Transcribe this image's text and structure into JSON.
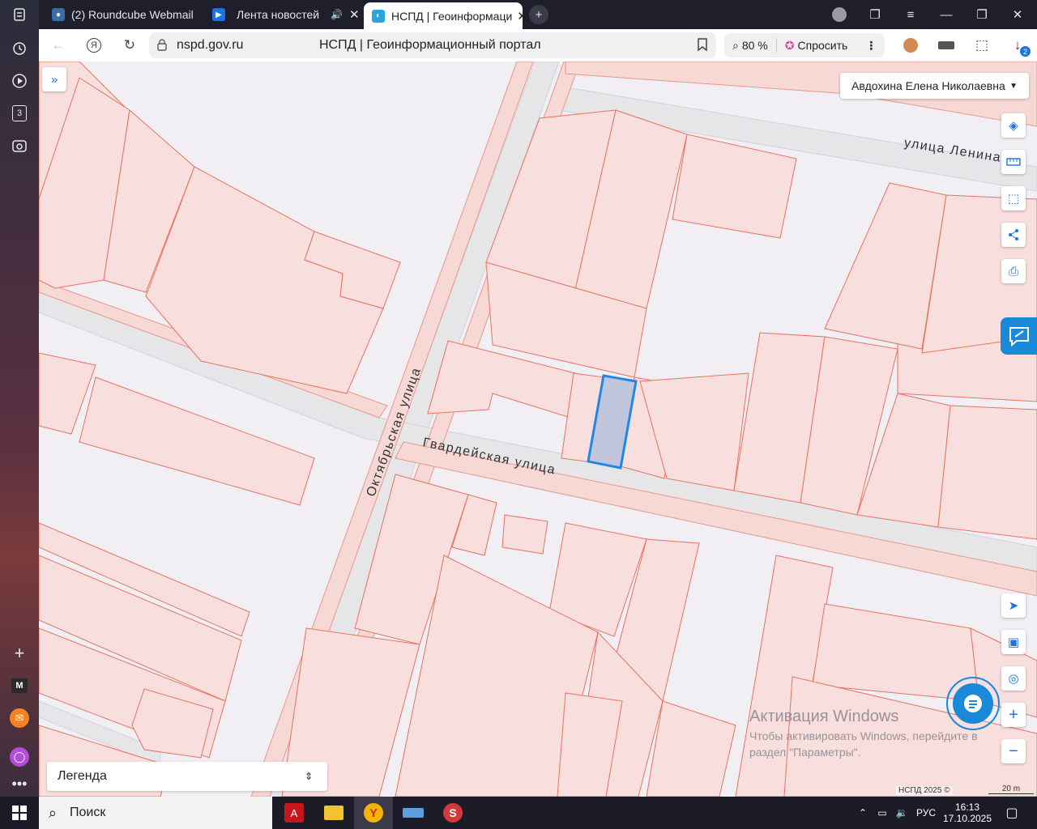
{
  "browser": {
    "tabs": [
      {
        "label": "(2) Roundcube Webmail ::",
        "icon": "roundcube-icon"
      },
      {
        "label": "Лента новостей",
        "icon": "video-play-icon"
      },
      {
        "label": "НСПД | Геоинформаци",
        "icon": "nspd-globe-icon",
        "active": true
      }
    ],
    "address": {
      "host": "nspd.gov.ru",
      "page_title": "НСПД | Геоинформационный портал",
      "zoom": "80 %",
      "ask_label": "Спросить"
    },
    "download_badge": "2",
    "sidebar_badge": "3",
    "sidebar_m": "M"
  },
  "map": {
    "user_name": "Авдохина Елена Николаевна",
    "streets": {
      "lenina": "улица  Ленина",
      "oktyabrskaya": "Октябрьская  улица",
      "gvardeyskaya": "Гвардейская  улица"
    },
    "legend_label": "Легенда",
    "watermark": {
      "title": "Активация Windows",
      "text": "Чтобы активировать Windows, перейдите в раздел \"Параметры\"."
    },
    "attribution": "НСПД 2025 ©",
    "scale_label": "20 m",
    "colors": {
      "parcel_stroke": "#e8735f",
      "parcel_fill": "#f8dedd",
      "selected_stroke": "#1e88e5",
      "selected_fill": "#c2c6dc",
      "road": "#e6e6e9"
    }
  },
  "taskbar": {
    "search_placeholder": "Поиск",
    "lang": "РУС",
    "time": "16:13",
    "date": "17.10.2025"
  }
}
